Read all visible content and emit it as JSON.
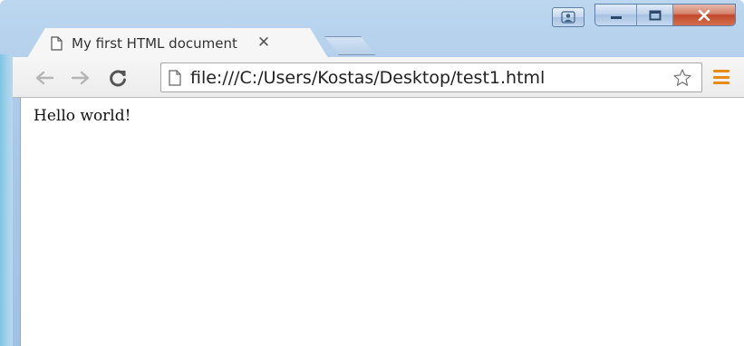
{
  "window": {
    "caption_buttons": [
      "user-icon",
      "minimize-icon",
      "maximize-icon",
      "close-icon"
    ],
    "close_color": "#c2482a"
  },
  "tab": {
    "title": "My first HTML document",
    "close_glyph": "✕",
    "icon": "page-icon"
  },
  "toolbar": {
    "back_icon": "arrow-left-icon",
    "forward_icon": "arrow-right-icon",
    "reload_icon": "reload-icon",
    "menu_icon": "hamburger-menu-icon",
    "menu_color": "#e88b16"
  },
  "omnibox": {
    "url": "file:///C:/Users/Kostas/Desktop/test1.html",
    "bookmark_icon": "star-icon"
  },
  "page": {
    "body_text": "Hello world!"
  }
}
